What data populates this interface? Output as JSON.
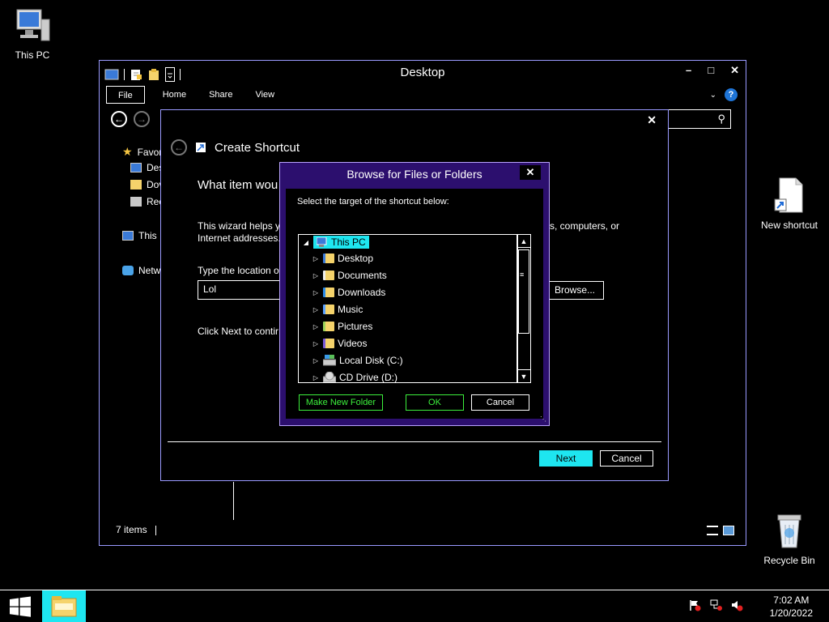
{
  "desktop": {
    "icons": {
      "this_pc": "This PC",
      "new_shortcut": "New shortcut",
      "recycle_bin": "Recycle Bin"
    }
  },
  "explorer": {
    "title": "Desktop",
    "tabs": [
      "File",
      "Home",
      "Share",
      "View"
    ],
    "nav_items": {
      "favorites": "Favor",
      "desktop": "Des",
      "downloads": "Dov",
      "recent": "Rec",
      "this_pc": "This I",
      "network": "Netw"
    },
    "status": "7 items"
  },
  "wizard": {
    "title": "Create Shortcut",
    "question": "What item wou",
    "description_left": "This wizard helps yo",
    "description_left2": "Internet addresses.",
    "description_right": "s, computers, or",
    "location_label": "Type the location o",
    "location_value": "Lol",
    "browse_label": "Browse...",
    "click_next": "Click Next to contir",
    "next_label": "Next",
    "cancel_label": "Cancel"
  },
  "browse": {
    "title": "Browse for Files or Folders",
    "prompt": "Select the target of the shortcut below:",
    "root": "This PC",
    "items": [
      {
        "label": "Desktop",
        "icon": "desktop-folder-icon"
      },
      {
        "label": "Documents",
        "icon": "documents-folder-icon"
      },
      {
        "label": "Downloads",
        "icon": "downloads-folder-icon"
      },
      {
        "label": "Music",
        "icon": "music-folder-icon"
      },
      {
        "label": "Pictures",
        "icon": "pictures-folder-icon"
      },
      {
        "label": "Videos",
        "icon": "videos-folder-icon"
      },
      {
        "label": "Local Disk (C:)",
        "icon": "local-disk-icon"
      },
      {
        "label": "CD Drive (D:)",
        "icon": "cd-drive-icon"
      }
    ],
    "make_new_folder": "Make New Folder",
    "ok": "OK",
    "cancel": "Cancel"
  },
  "taskbar": {
    "time": "7:02 AM",
    "date": "1/20/2022"
  },
  "colors": {
    "accent_cyan": "#1ee6f0",
    "dialog_purple": "#2c0f6e",
    "border_lavender": "#9a9aff",
    "green_button": "#3cf03c"
  }
}
